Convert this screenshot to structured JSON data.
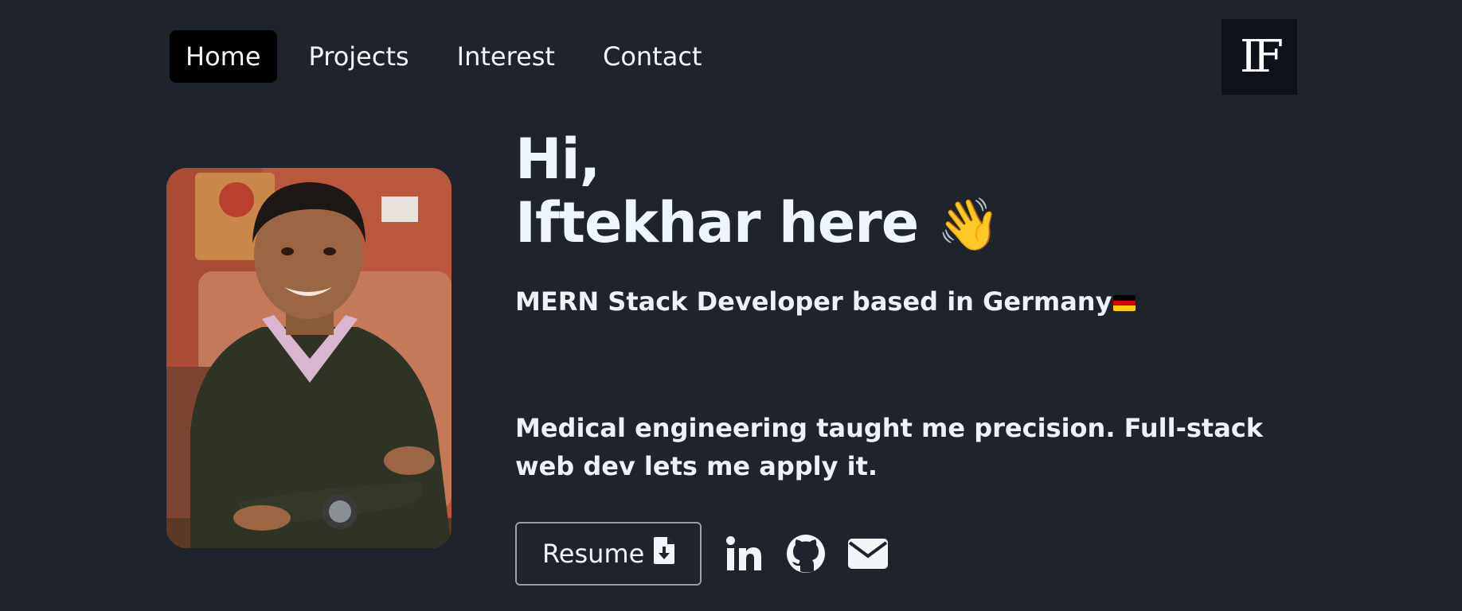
{
  "nav": {
    "items": [
      {
        "label": "Home",
        "active": true
      },
      {
        "label": "Projects",
        "active": false
      },
      {
        "label": "Interest",
        "active": false
      },
      {
        "label": "Contact",
        "active": false
      }
    ],
    "logo": "IF"
  },
  "hero": {
    "greeting_line1": "Hi,",
    "greeting_line2": "Iftekhar here",
    "wave_emoji": "👋",
    "subtitle": "MERN Stack Developer based in Germany",
    "intro": "Medical engineering taught me precision. Full-stack web dev lets me apply it."
  },
  "actions": {
    "resume_label": "Resume",
    "icons": [
      "file-download-icon",
      "linkedin-icon",
      "github-icon",
      "envelope-icon"
    ]
  },
  "colors": {
    "background": "#1f232b",
    "nav_active_bg": "#000000",
    "logo_bg": "#0f121a",
    "text": "#f3f5f8",
    "button_border": "#9aa0a8"
  }
}
